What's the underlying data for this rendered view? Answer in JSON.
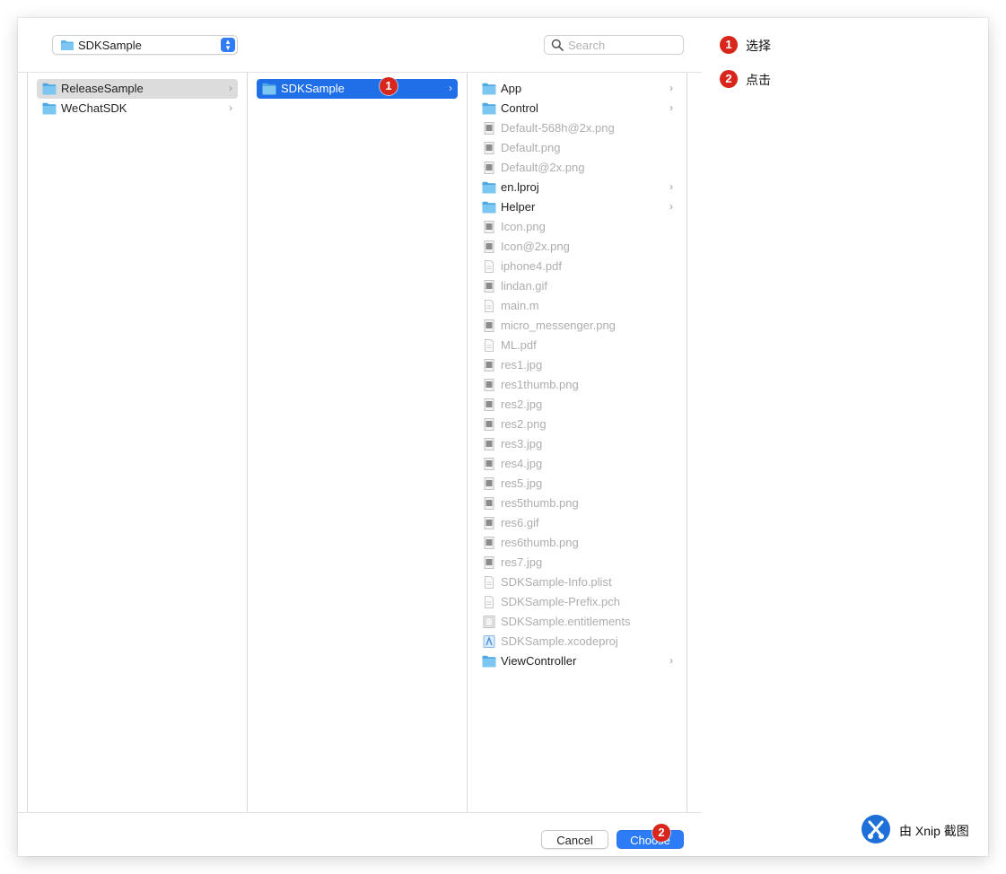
{
  "toolbar": {
    "path_popup_label": "SDKSample",
    "search_placeholder": "Search"
  },
  "columns": [
    {
      "items": [
        {
          "name": "ReleaseSample",
          "icon": "folder-icon",
          "type": "folder",
          "state": "parent"
        },
        {
          "name": "WeChatSDK",
          "icon": "folder-icon",
          "type": "folder",
          "state": "normal"
        }
      ]
    },
    {
      "items": [
        {
          "name": "SDKSample",
          "icon": "folder-icon",
          "type": "folder",
          "state": "selected",
          "badge": "1"
        }
      ]
    },
    {
      "items": [
        {
          "name": "App",
          "icon": "folder-icon",
          "type": "folder",
          "state": "normal"
        },
        {
          "name": "Control",
          "icon": "folder-icon",
          "type": "folder",
          "state": "normal"
        },
        {
          "name": "Default-568h@2x.png",
          "icon": "image-file-icon",
          "type": "file",
          "state": "disabled"
        },
        {
          "name": "Default.png",
          "icon": "image-file-icon",
          "type": "file",
          "state": "disabled"
        },
        {
          "name": "Default@2x.png",
          "icon": "image-file-icon",
          "type": "file",
          "state": "disabled"
        },
        {
          "name": "en.lproj",
          "icon": "folder-icon",
          "type": "folder",
          "state": "normal"
        },
        {
          "name": "Helper",
          "icon": "folder-icon",
          "type": "folder",
          "state": "normal"
        },
        {
          "name": "Icon.png",
          "icon": "image-file-icon",
          "type": "file",
          "state": "disabled"
        },
        {
          "name": "Icon@2x.png",
          "icon": "image-file-icon",
          "type": "file",
          "state": "disabled"
        },
        {
          "name": "iphone4.pdf",
          "icon": "pdf-file-icon",
          "type": "file",
          "state": "disabled"
        },
        {
          "name": "lindan.gif",
          "icon": "image-file-icon",
          "type": "file",
          "state": "disabled"
        },
        {
          "name": "main.m",
          "icon": "source-file-icon",
          "type": "file",
          "state": "disabled"
        },
        {
          "name": "micro_messenger.png",
          "icon": "image-file-icon",
          "type": "file",
          "state": "disabled"
        },
        {
          "name": "ML.pdf",
          "icon": "pdf-file-icon",
          "type": "file",
          "state": "disabled"
        },
        {
          "name": "res1.jpg",
          "icon": "image-file-icon",
          "type": "file",
          "state": "disabled"
        },
        {
          "name": "res1thumb.png",
          "icon": "image-file-icon",
          "type": "file",
          "state": "disabled"
        },
        {
          "name": "res2.jpg",
          "icon": "image-file-icon",
          "type": "file",
          "state": "disabled"
        },
        {
          "name": "res2.png",
          "icon": "image-file-icon",
          "type": "file",
          "state": "disabled"
        },
        {
          "name": "res3.jpg",
          "icon": "image-file-icon",
          "type": "file",
          "state": "disabled"
        },
        {
          "name": "res4.jpg",
          "icon": "image-file-icon",
          "type": "file",
          "state": "disabled"
        },
        {
          "name": "res5.jpg",
          "icon": "image-file-icon",
          "type": "file",
          "state": "disabled"
        },
        {
          "name": "res5thumb.png",
          "icon": "image-file-icon",
          "type": "file",
          "state": "disabled"
        },
        {
          "name": "res6.gif",
          "icon": "image-file-icon",
          "type": "file",
          "state": "disabled"
        },
        {
          "name": "res6thumb.png",
          "icon": "image-file-icon",
          "type": "file",
          "state": "disabled"
        },
        {
          "name": "res7.jpg",
          "icon": "image-file-icon",
          "type": "file",
          "state": "disabled"
        },
        {
          "name": "SDKSample-Info.plist",
          "icon": "document-file-icon",
          "type": "file",
          "state": "disabled"
        },
        {
          "name": "SDKSample-Prefix.pch",
          "icon": "document-file-icon",
          "type": "file",
          "state": "disabled"
        },
        {
          "name": "SDKSample.entitlements",
          "icon": "entitlements-file-icon",
          "type": "file",
          "state": "disabled"
        },
        {
          "name": "SDKSample.xcodeproj",
          "icon": "xcodeproj-file-icon",
          "type": "file",
          "state": "disabled"
        },
        {
          "name": "ViewController",
          "icon": "folder-icon",
          "type": "folder",
          "state": "normal"
        }
      ]
    }
  ],
  "buttons": {
    "cancel_label": "Cancel",
    "choose_label": "Choose",
    "choose_badge": "2"
  },
  "legend": [
    {
      "badge": "1",
      "text": "选择"
    },
    {
      "badge": "2",
      "text": "点击"
    }
  ],
  "watermark": {
    "text": "由 Xnip 截图"
  },
  "colors": {
    "accent": "#1f6fe8",
    "badge": "#d9261c",
    "folder": "#5fb4ea"
  }
}
